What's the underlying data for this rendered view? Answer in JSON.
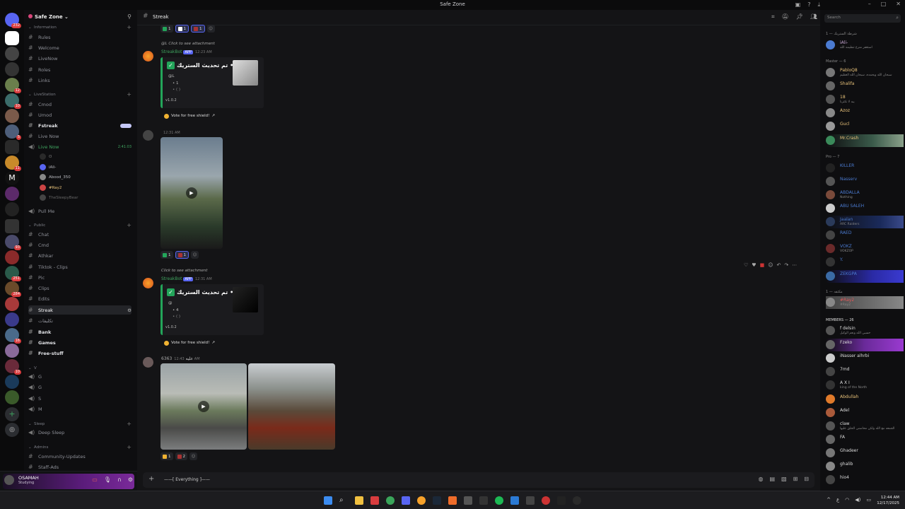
{
  "window": {
    "title": "Safe Zone"
  },
  "server_rail": {
    "badges": [
      "232",
      "12",
      "10",
      "5",
      "11",
      "93",
      "251",
      "284",
      "16",
      "10"
    ]
  },
  "server": {
    "name": "Safe Zone ⌄"
  },
  "channels": {
    "cat_information": "Information",
    "info_items": [
      "Rules",
      "Welcome",
      "LiveNow",
      "Roles",
      "Links"
    ],
    "cat_livestation": "LiveStation",
    "live_items": [
      "Cmod",
      "Umod",
      "Fstreak",
      "Live Now"
    ],
    "voice_live": "Live Now",
    "voice_timer": "2:41:03",
    "voice_users": [
      "iAli-",
      "Abood_350",
      "#Ray2",
      "TheSleepyBear"
    ],
    "pull_me": "Pull Me",
    "cat_public": "Public",
    "public_items": [
      "Chat",
      "Cmd",
      "Athkar",
      "Tiktok - Clips",
      "Pic",
      "Clips",
      "Edits",
      "Streak",
      "تكليفات",
      "Bank",
      "Games",
      "Free-stuff"
    ],
    "cat_v": "V",
    "v_items": [
      "G",
      "G",
      "S",
      "M"
    ],
    "cat_sleep": "Sleep",
    "sleep_item": "Deep Sleep",
    "cat_admins": "Admins",
    "admin_items": [
      "Community-Updates",
      "Staff-Ads"
    ]
  },
  "user_panel": {
    "name": "OSAMAH",
    "status": "Studying"
  },
  "chat": {
    "channel": "Streak",
    "reply1": "@L Click to see attachment",
    "bot_name": "StreakBot",
    "app_tag": "APP",
    "time1": "12:23 AM",
    "embed_title": "تم تحديث الستريك •",
    "embed1_mention": "@L",
    "embed1_count": "• 1",
    "embed1_shields": "• ( )",
    "version": "v1.0.2",
    "vote_label": "Vote for free shield!",
    "top_reactions": [
      "1",
      "1",
      "1"
    ],
    "time2": "12:31 AM",
    "video_reactions": [
      "1",
      "1"
    ],
    "reply2": "Click to see attachment",
    "time3": "12:31 AM",
    "embed2_mention": "@",
    "embed2_count": "• 4",
    "embed2_shields": "• ( )",
    "author4": "عليه",
    "author4_tag": "6363",
    "time4": "12:43 AM",
    "photo_reactions": [
      "1",
      "2"
    ],
    "composer_placeholder": "Everything"
  },
  "members": {
    "search_placeholder": "Search",
    "group1": "شرطة الستريك — 1",
    "group2": "Master — 6",
    "group3": "Pro — 7",
    "group4": "مكثفه — 1",
    "group5": "MEMBERS — 26",
    "list": [
      {
        "name": "iAli-",
        "status": "استغفر منرع تنظيمه الله",
        "color": "#c9a8d4"
      },
      {
        "name": "PabloQ8",
        "status": "سبحان الله وبحمده، سبحان الله العظيم",
        "color": "#e8c27a"
      },
      {
        "name": "Shalifa",
        "status": "",
        "color": "#e8c27a"
      },
      {
        "name": "18",
        "status": "يبه لا تكثرنا",
        "color": "#e8c27a"
      },
      {
        "name": "Azoz",
        "status": "",
        "color": "#e8c27a"
      },
      {
        "name": "Gucl",
        "status": "",
        "color": "#e8c27a"
      },
      {
        "name": "Mr.Crash",
        "status": "",
        "color": "#e8c27a"
      },
      {
        "name": "KILLER",
        "status": "",
        "color": "#4b7bd1"
      },
      {
        "name": "Nasserv",
        "status": "",
        "color": "#4b7bd1"
      },
      {
        "name": "ABDALLA",
        "status": "Nothing",
        "color": "#4b7bd1"
      },
      {
        "name": "ABU SALEH",
        "status": "",
        "color": "#4b7bd1"
      },
      {
        "name": "Jaalan",
        "status": "ARC Raiders",
        "color": "#4b7bd1"
      },
      {
        "name": "RAED",
        "status": "",
        "color": "#4b7bd1"
      },
      {
        "name": "VOKZ",
        "status": "VOKZOP",
        "color": "#4b7bd1"
      },
      {
        "name": "Y.",
        "status": "",
        "color": "#4b7bd1"
      },
      {
        "name": "ZEKGPA",
        "status": "",
        "color": "#4b7bd1"
      },
      {
        "name": "#Ray2",
        "status": "#Ray2",
        "color": "#e05a5a"
      },
      {
        "name": "f delsin",
        "status": "حسبي الله ونعم الوكيل",
        "color": "#ddd"
      },
      {
        "name": "Fzeko",
        "status": "",
        "color": "#ddd"
      },
      {
        "name": "iNasser alhrbi",
        "status": "",
        "color": "#ddd"
      },
      {
        "name": "7md",
        "status": "",
        "color": "#ddd"
      },
      {
        "name": "A X I",
        "status": "king of the North",
        "color": "#ddd"
      },
      {
        "name": "Abdullah",
        "status": "",
        "color": "#e8c27a"
      },
      {
        "name": "Adel",
        "status": "",
        "color": "#ddd"
      },
      {
        "name": "claw",
        "status": "الجمعه مع الله ولكن محاسني الخلق عليها",
        "color": "#ddd"
      },
      {
        "name": "FA",
        "status": "",
        "color": "#ddd"
      },
      {
        "name": "Ghadeer",
        "status": "",
        "color": "#ddd"
      },
      {
        "name": "ghalib",
        "status": "",
        "color": "#ddd"
      },
      {
        "name": "hio4",
        "status": "",
        "color": "#ddd"
      }
    ]
  },
  "taskbar": {
    "lang": "ع",
    "time": "12:44 AM",
    "date": "12/17/2025"
  },
  "icons": [
    "gear-icon",
    "microphone-icon",
    "headphones-icon",
    "search-icon",
    "pin-icon",
    "members-icon",
    "play-icon",
    "plus-icon"
  ]
}
